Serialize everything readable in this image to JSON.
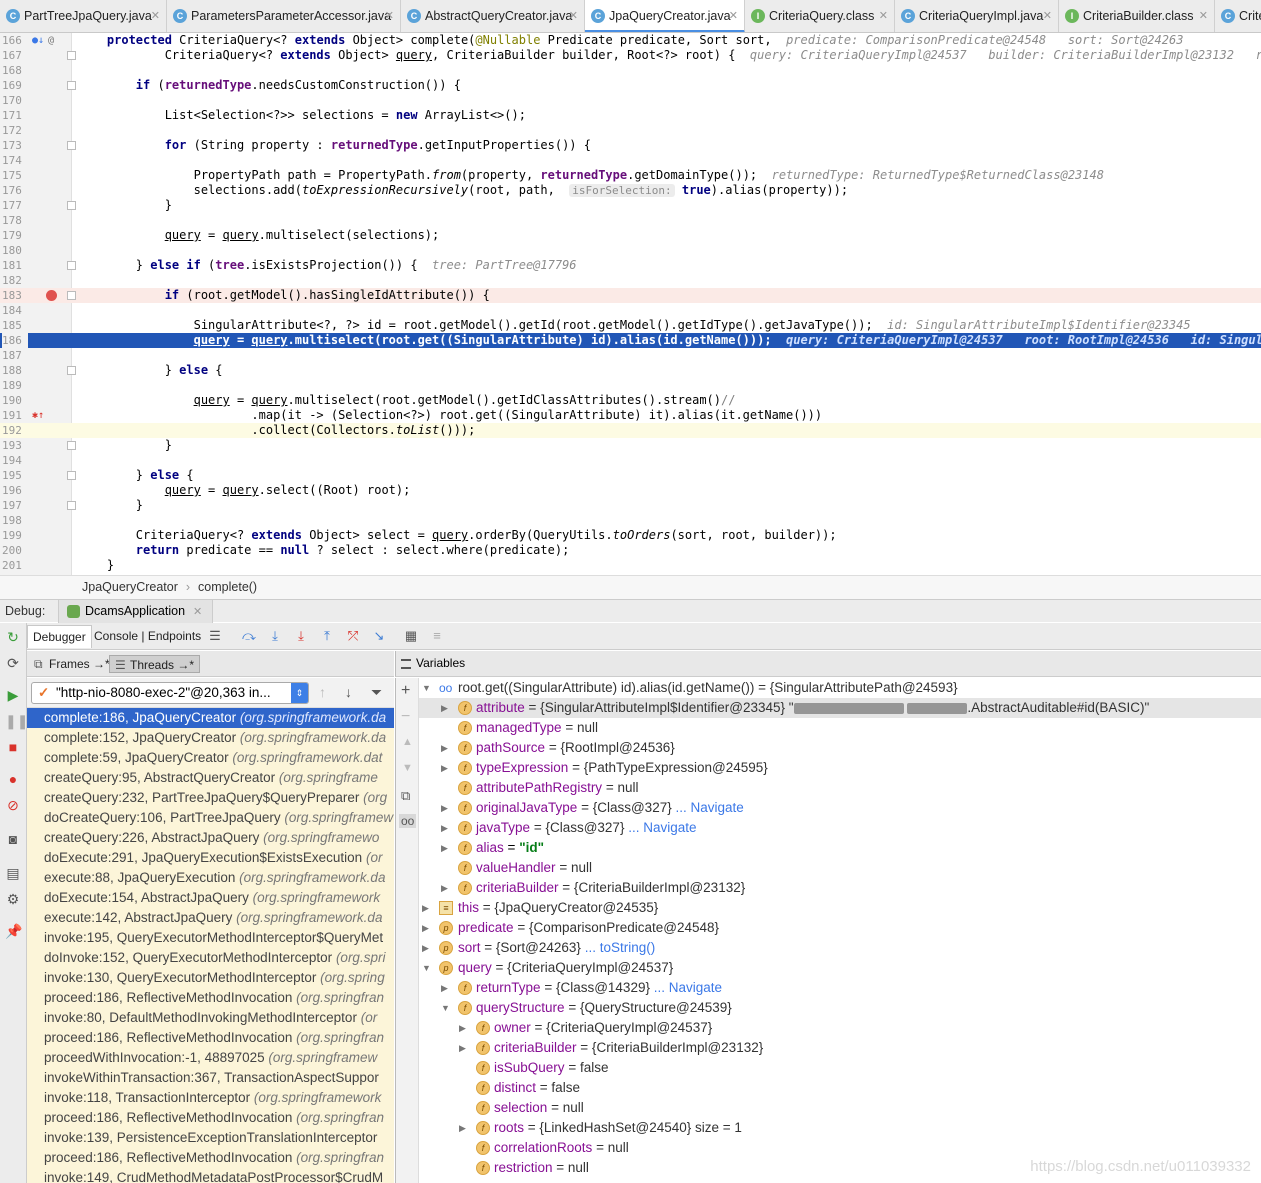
{
  "tabs": [
    {
      "label": "PartTreeJpaQuery.java",
      "icon": "C"
    },
    {
      "label": "ParametersParameterAccessor.java",
      "icon": "C"
    },
    {
      "label": "AbstractQueryCreator.java",
      "icon": "C"
    },
    {
      "label": "JpaQueryCreator.java",
      "icon": "C"
    },
    {
      "label": "CriteriaQuery.class",
      "icon": "I"
    },
    {
      "label": "CriteriaQueryImpl.java",
      "icon": "C"
    },
    {
      "label": "CriteriaBuilder.class",
      "icon": "I"
    },
    {
      "label": "Crite",
      "icon": "C"
    }
  ],
  "editor": {
    "line_numbers": [
      "166",
      "167",
      "168",
      "169",
      "170",
      "171",
      "172",
      "173",
      "174",
      "175",
      "176",
      "177",
      "178",
      "179",
      "180",
      "181",
      "182",
      "183",
      "184",
      "185",
      "186",
      "187",
      "188",
      "189",
      "190",
      "191",
      "192",
      "193",
      "194",
      "195",
      "196",
      "197",
      "198",
      "199",
      "200",
      "201"
    ],
    "hints": {
      "l166": "predicate: ComparisonPredicate@24548   sort: Sort@24263",
      "l167": "query: CriteriaQueryImpl@24537   builder: CriteriaBuilderImpl@23132   root: Ro",
      "l175": "returnedType: ReturnedType$ReturnedClass@23148",
      "l176_param": "isForSelection:",
      "l181": "tree: PartTree@17796",
      "l185": "id: SingularAttributeImpl$Identifier@23345",
      "l186": "query: CriteriaQueryImpl@24537   root: RootImpl@24536   id: SingularAttri"
    }
  },
  "breadcrumb": {
    "class": "JpaQueryCreator",
    "method": "complete()"
  },
  "debug": {
    "label": "Debug:",
    "app": "DcamsApplication",
    "subtabs": [
      "Debugger",
      "Console | Endpoints"
    ],
    "frames_tab": "Frames →*",
    "threads_tab": "Threads →*",
    "variables_label": "Variables",
    "thread": "\"http-nio-8080-exec-2\"@20,363 in..."
  },
  "frames": [
    {
      "m": "complete:186, JpaQueryCreator",
      "p": "(org.springframework.da"
    },
    {
      "m": "complete:152, JpaQueryCreator",
      "p": "(org.springframework.da"
    },
    {
      "m": "complete:59, JpaQueryCreator",
      "p": "(org.springframework.dat"
    },
    {
      "m": "createQuery:95, AbstractQueryCreator",
      "p": "(org.springframe"
    },
    {
      "m": "createQuery:232, PartTreeJpaQuery$QueryPreparer",
      "p": "(org"
    },
    {
      "m": "doCreateQuery:106, PartTreeJpaQuery",
      "p": "(org.springframew"
    },
    {
      "m": "createQuery:226, AbstractJpaQuery",
      "p": "(org.springframewo"
    },
    {
      "m": "doExecute:291, JpaQueryExecution$ExistsExecution",
      "p": "(or"
    },
    {
      "m": "execute:88, JpaQueryExecution",
      "p": "(org.springframework.da"
    },
    {
      "m": "doExecute:154, AbstractJpaQuery",
      "p": "(org.springframework"
    },
    {
      "m": "execute:142, AbstractJpaQuery",
      "p": "(org.springframework.da"
    },
    {
      "m": "invoke:195, QueryExecutorMethodInterceptor$QueryMet",
      "p": ""
    },
    {
      "m": "doInvoke:152, QueryExecutorMethodInterceptor",
      "p": "(org.spri"
    },
    {
      "m": "invoke:130, QueryExecutorMethodInterceptor",
      "p": "(org.spring"
    },
    {
      "m": "proceed:186, ReflectiveMethodInvocation",
      "p": "(org.springfran"
    },
    {
      "m": "invoke:80, DefaultMethodInvokingMethodInterceptor",
      "p": "(or"
    },
    {
      "m": "proceed:186, ReflectiveMethodInvocation",
      "p": "(org.springfran"
    },
    {
      "m": "proceedWithInvocation:-1, 48897025",
      "p": "(org.springframew"
    },
    {
      "m": "invokeWithinTransaction:367, TransactionAspectSuppor",
      "p": ""
    },
    {
      "m": "invoke:118, TransactionInterceptor",
      "p": "(org.springframework"
    },
    {
      "m": "proceed:186, ReflectiveMethodInvocation",
      "p": "(org.springfran"
    },
    {
      "m": "invoke:139, PersistenceExceptionTranslationInterceptor",
      "p": ""
    },
    {
      "m": "proceed:186, ReflectiveMethodInvocation",
      "p": "(org.springfran"
    },
    {
      "m": "invoke:149, CrudMethodMetadataPostProcessor$CrudM",
      "p": ""
    }
  ],
  "variables": {
    "root": "root.get((SingularAttribute) id).alias(id.getName()) = {SingularAttributePath@24593}",
    "attribute": {
      "name": "attribute",
      "val": "= {SingularAttributeImpl$Identifier@23345} \"",
      "tail": ".AbstractAuditable#id(BASIC)\""
    },
    "managedType": {
      "name": "managedType",
      "val": "= null"
    },
    "pathSource": {
      "name": "pathSource",
      "val": "= {RootImpl@24536}"
    },
    "typeExpression": {
      "name": "typeExpression",
      "val": "= {PathTypeExpression@24595}"
    },
    "attributePathRegistry": {
      "name": "attributePathRegistry",
      "val": "= null"
    },
    "originalJavaType": {
      "name": "originalJavaType",
      "val": "= {Class@327}",
      "nav": "... Navigate"
    },
    "javaType": {
      "name": "javaType",
      "val": "= {Class@327}",
      "nav": "... Navigate"
    },
    "alias": {
      "name": "alias",
      "eq": "=",
      "str": "\"id\""
    },
    "valueHandler": {
      "name": "valueHandler",
      "val": "= null"
    },
    "criteriaBuilder": {
      "name": "criteriaBuilder",
      "val": "= {CriteriaBuilderImpl@23132}"
    },
    "this": {
      "name": "this",
      "val": "= {JpaQueryCreator@24535}"
    },
    "predicate": {
      "name": "predicate",
      "val": "= {ComparisonPredicate@24548}"
    },
    "sort": {
      "name": "sort",
      "val": "= {Sort@24263}",
      "nav": "... toString()"
    },
    "query": {
      "name": "query",
      "val": "= {CriteriaQueryImpl@24537}"
    },
    "returnType": {
      "name": "returnType",
      "val": "= {Class@14329}",
      "nav": "... Navigate"
    },
    "queryStructure": {
      "name": "queryStructure",
      "val": "= {QueryStructure@24539}"
    },
    "owner": {
      "name": "owner",
      "val": "= {CriteriaQueryImpl@24537}"
    },
    "criteriaBuilder2": {
      "name": "criteriaBuilder",
      "val": "= {CriteriaBuilderImpl@23132}"
    },
    "isSubQuery": {
      "name": "isSubQuery",
      "val": "= false"
    },
    "distinct": {
      "name": "distinct",
      "val": "= false"
    },
    "selection": {
      "name": "selection",
      "val": "= null"
    },
    "roots": {
      "name": "roots",
      "val": "= {LinkedHashSet@24540}  size = 1"
    },
    "correlationRoots": {
      "name": "correlationRoots",
      "val": "= null"
    },
    "restriction": {
      "name": "restriction",
      "val": "= null"
    }
  },
  "watermark": "https://blog.csdn.net/u011039332"
}
